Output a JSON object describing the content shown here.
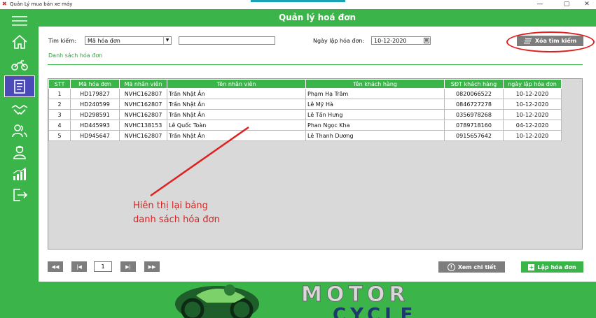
{
  "window": {
    "title": "Quản Lý mua bán xe máy",
    "min": "—",
    "max": "▢",
    "close": "✕"
  },
  "header": {
    "title": "Quản lý hoá đơn"
  },
  "sidebar": {
    "items": [
      {
        "icon": "menu-icon"
      },
      {
        "icon": "home-icon"
      },
      {
        "icon": "motorbike-icon"
      },
      {
        "icon": "invoice-icon",
        "active": true
      },
      {
        "icon": "handshake-icon"
      },
      {
        "icon": "users-icon"
      },
      {
        "icon": "employee-icon"
      },
      {
        "icon": "chart-icon"
      },
      {
        "icon": "logout-icon"
      }
    ]
  },
  "search": {
    "label": "Tìm kiếm:",
    "field_value": "Mã hóa đơn",
    "keyword_value": "",
    "date_label": "Ngày lập hóa đơn:",
    "date_value": "10-12-2020",
    "clear_label": "Xóa tìm kiếm"
  },
  "list": {
    "title": "Danh sách hóa đơn"
  },
  "table": {
    "columns": [
      "STT",
      "Mã hóa đơn",
      "Mã nhân viên",
      "Tên nhân viên",
      "Tên khách hàng",
      "SĐT khách hàng",
      "ngày lập hóa đơn"
    ],
    "rows": [
      [
        "1",
        "HD179827",
        "NVHC162807",
        "Trần Nhật Ân",
        "Phạm Hạ Trâm",
        "0820066522",
        "10-12-2020"
      ],
      [
        "2",
        "HD240599",
        "NVHC162807",
        "Trần Nhật Ân",
        "Lê Mỹ Hà",
        "0846727278",
        "10-12-2020"
      ],
      [
        "3",
        "HD298591",
        "NVHC162807",
        "Trần Nhật Ân",
        "Lê Tấn Hưng",
        "0356978268",
        "10-12-2020"
      ],
      [
        "4",
        "HD445993",
        "NVHC138153",
        "Lê Quốc Toàn",
        "Phan Ngọc Kha",
        "0789718160",
        "04-12-2020"
      ],
      [
        "5",
        "HD945647",
        "NVHC162807",
        "Trần Nhật Ân",
        "Lê Thanh Dương",
        "0915657642",
        "10-12-2020"
      ]
    ]
  },
  "annotation": {
    "line1": "Hiên thị lại bảng",
    "line2": "danh sách hóa đơn",
    "color": "#e02020"
  },
  "pagination": {
    "first": "◀◀",
    "prev": "|◀",
    "page": "1",
    "next": "▶|",
    "last": "▶▶"
  },
  "actions": {
    "view_detail": "Xem chi tiết",
    "create_invoice": "Lập hóa đơn"
  },
  "footer": {
    "logo_text_top": "MOTOR",
    "logo_text_bottom": "CYCLE"
  },
  "colors": {
    "brand_green": "#3bb54a",
    "active_nav": "#4a4ab8",
    "button_gray": "#7d7d7d"
  }
}
